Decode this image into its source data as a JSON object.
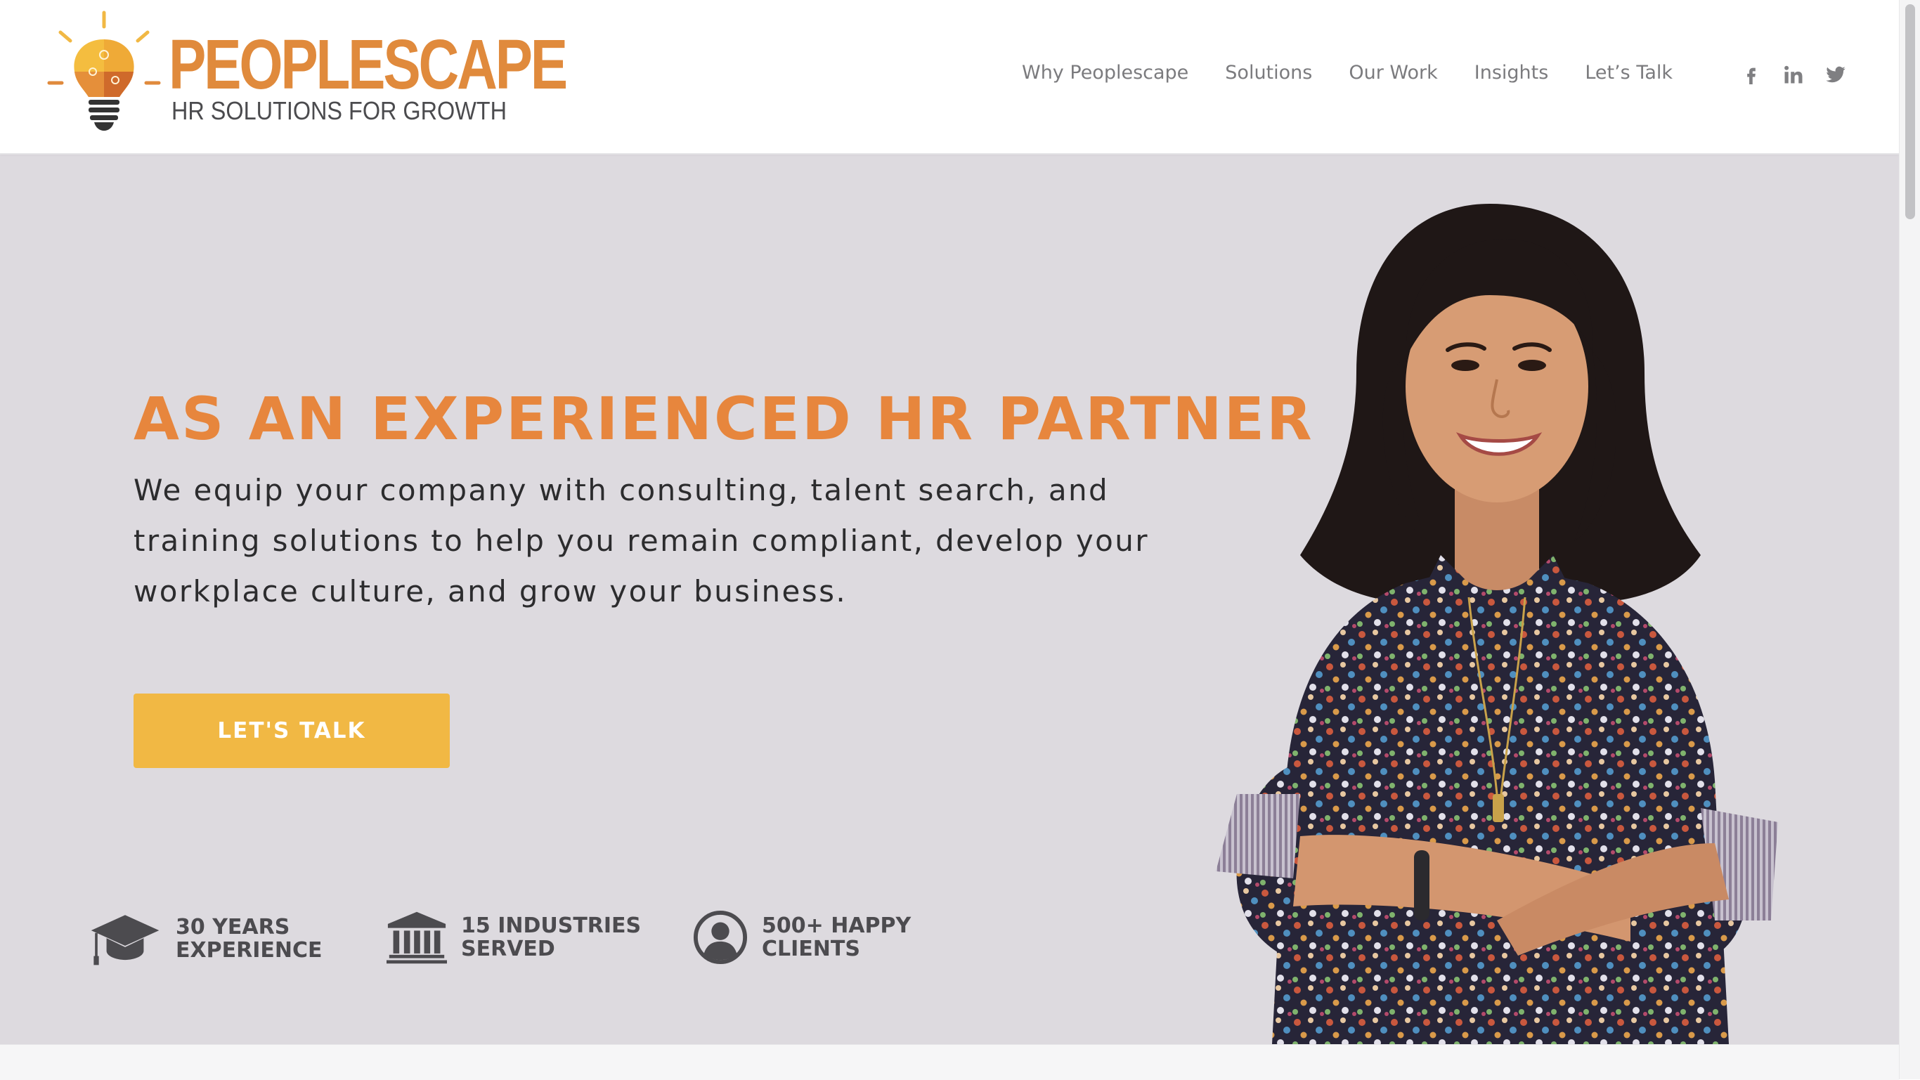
{
  "brand": {
    "name": "PEOPLESCAPE",
    "tagline": "HR SOLUTIONS FOR GROWTH",
    "colors": {
      "orange": "#e7863d",
      "yellow": "#f1b844",
      "hero_bg": "#dddadf",
      "text_dark": "#2c2c2e",
      "nav_gray": "#7b7b7e"
    }
  },
  "nav": {
    "items": [
      {
        "label": "Why Peoplescape"
      },
      {
        "label": "Solutions"
      },
      {
        "label": "Our Work"
      },
      {
        "label": "Insights"
      },
      {
        "label": "Let’s Talk"
      }
    ]
  },
  "social": {
    "icons": [
      "facebook-icon",
      "linkedin-icon",
      "twitter-icon"
    ]
  },
  "hero": {
    "headline": "AS AN EXPERIENCED HR PARTNER",
    "subtext": "We equip your company with consulting, talent search, and training solutions to help you remain compliant, develop your workplace culture, and grow your business.",
    "cta_label": "LET'S TALK",
    "stats": [
      {
        "icon": "graduation-cap-icon",
        "line1": "30 YEARS",
        "line2": "EXPERIENCE"
      },
      {
        "icon": "building-columns-icon",
        "line1": "15 INDUSTRIES",
        "line2": "SERVED"
      },
      {
        "icon": "user-circle-icon",
        "line1": "500+ HAPPY",
        "line2": "CLIENTS"
      }
    ],
    "image_subject": "smiling-woman-arms-crossed"
  }
}
